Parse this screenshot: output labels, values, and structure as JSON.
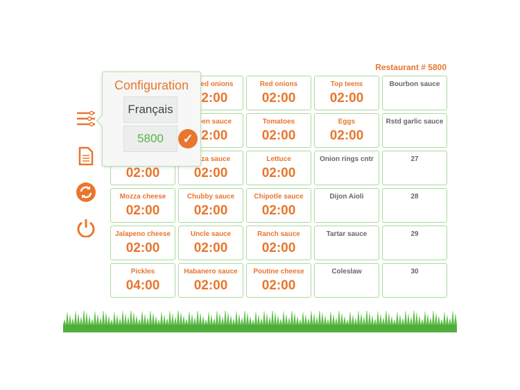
{
  "header": {
    "restaurant": "Restaurant # 5800"
  },
  "config": {
    "title": "Configuration",
    "language": "Français",
    "restaurant_number": "5800"
  },
  "colors": {
    "accent": "#e8762d",
    "border": "#a9d9a0",
    "grass": "#5bbd46"
  },
  "cells": [
    {
      "label": "",
      "time": ""
    },
    {
      "label": "Sliced onions",
      "time": "02:00"
    },
    {
      "label": "Red onions",
      "time": "02:00"
    },
    {
      "label": "Top teens",
      "time": "02:00"
    },
    {
      "label": "Bourbon sauce",
      "time": ""
    },
    {
      "label": "",
      "time": ""
    },
    {
      "label": "Green sauce",
      "time": "02:00"
    },
    {
      "label": "Tomatoes",
      "time": "02:00"
    },
    {
      "label": "Eggs",
      "time": "02:00"
    },
    {
      "label": "Rstd garlic sauce",
      "time": ""
    },
    {
      "label": "",
      "time": "02:00"
    },
    {
      "label": "Pizza sauce",
      "time": "02:00"
    },
    {
      "label": "Lettuce",
      "time": "02:00"
    },
    {
      "label": "Onion rings cntr",
      "time": ""
    },
    {
      "label": "27",
      "time": ""
    },
    {
      "label": "Mozza cheese",
      "time": "02:00"
    },
    {
      "label": "Chubby sauce",
      "time": "02:00"
    },
    {
      "label": "Chipotle sauce",
      "time": "02:00"
    },
    {
      "label": "Dijon Aioli",
      "time": ""
    },
    {
      "label": "28",
      "time": ""
    },
    {
      "label": "Jalapeno cheese",
      "time": "02:00"
    },
    {
      "label": "Uncle sauce",
      "time": "02:00"
    },
    {
      "label": "Ranch sauce",
      "time": "02:00"
    },
    {
      "label": "Tartar sauce",
      "time": ""
    },
    {
      "label": "29",
      "time": ""
    },
    {
      "label": "Pickles",
      "time": "04:00"
    },
    {
      "label": "Habanero sauce",
      "time": "02:00"
    },
    {
      "label": "Poutine cheese",
      "time": "02:00"
    },
    {
      "label": "Coleslaw",
      "time": ""
    },
    {
      "label": "30",
      "time": ""
    }
  ]
}
